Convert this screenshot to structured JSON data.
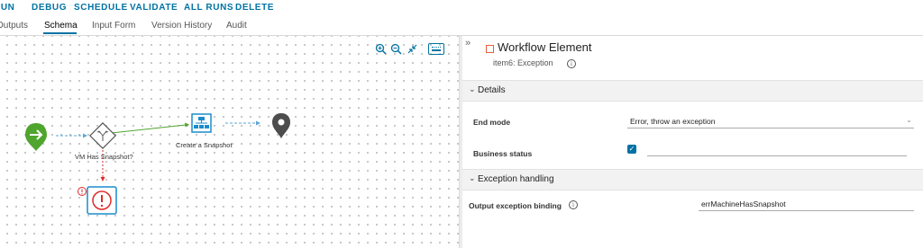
{
  "toolbar": {
    "run": "RUN",
    "debug": "DEBUG",
    "schedule": "SCHEDULE",
    "validate": "VALIDATE",
    "all_runs": "ALL RUNS",
    "delete": "DELETE"
  },
  "tabs": [
    "Outputs",
    "Schema",
    "Input Form",
    "Version History",
    "Audit"
  ],
  "active_tab": "Schema",
  "canvas": {
    "nodes": {
      "decision": "VM Has Snapshot?",
      "action": "Create a Snapshot"
    }
  },
  "panel": {
    "title": "Workflow Element",
    "subtitle": "item6: Exception",
    "details": {
      "header": "Details",
      "end_mode_label": "End mode",
      "end_mode_value": "Error, throw an exception",
      "business_status_label": "Business status",
      "business_status_checked": true
    },
    "exception": {
      "header": "Exception handling",
      "output_binding_label": "Output exception binding",
      "output_binding_value": "errMachineHasSnapshot"
    }
  },
  "colors": {
    "accent": "#0072a3",
    "start_node": "#4fa52e",
    "error": "#e02a2a",
    "end_node": "#4d4d4d"
  }
}
